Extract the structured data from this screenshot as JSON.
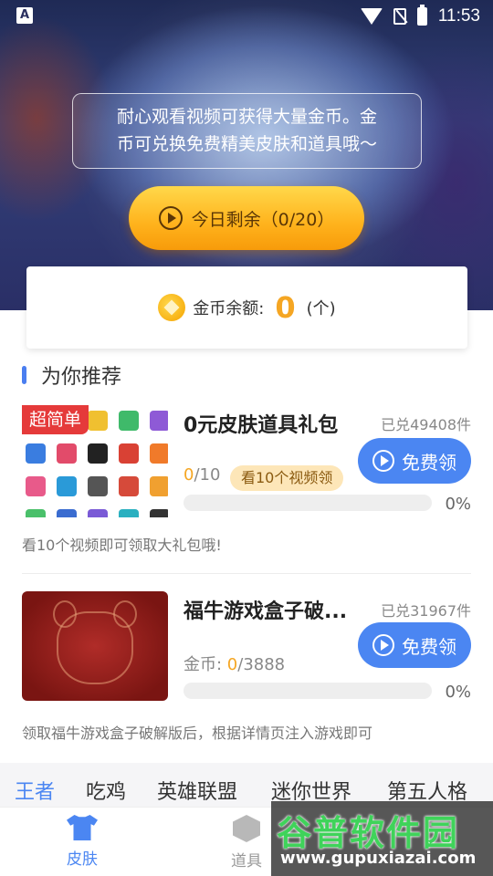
{
  "status_bar": {
    "left_icon": "A",
    "time": "11:53",
    "icons": [
      "wifi-icon",
      "no-sim-icon",
      "battery-charging-icon"
    ]
  },
  "hero": {
    "info_text_line1": "耐心观看视频可获得大量金币。金",
    "info_text_line2": "币可兑换免费精美皮肤和道具哦～",
    "remain_label": "今日剩余（0/20）"
  },
  "coin_balance": {
    "label": "金币余额:",
    "value": "0",
    "unit": "(个)"
  },
  "section": {
    "title": "为你推荐"
  },
  "items": [
    {
      "tag": "超简单",
      "title": "0元皮肤道具礼包",
      "redeemed": "已兑49408件",
      "button": "免费领",
      "progress_current": "0",
      "progress_total": "/10",
      "watch_hint": "看10个视频领",
      "percent": "0%",
      "progress_fraction": 0,
      "desc": "看10个视频即可领取大礼包哦!"
    },
    {
      "title": "福牛游戏盒子破...",
      "redeemed": "已兑31967件",
      "button": "免费领",
      "coin_label": "金币: ",
      "progress_current": "0",
      "progress_total": "/3888",
      "percent": "0%",
      "progress_fraction": 0,
      "desc": "领取福牛游戏盒子破解版后，根据详情页注入游戏即可"
    }
  ],
  "category_tabs": [
    "王者",
    "吃鸡",
    "英雄联盟",
    "迷你世界",
    "第五人格"
  ],
  "bottom_nav": [
    {
      "label": "皮肤",
      "icon": "shirt-icon",
      "active": true
    },
    {
      "label": "道具",
      "icon": "cube-icon",
      "active": false
    }
  ],
  "watermark": {
    "title": "谷普软件园",
    "url": "www.gupuxiazai.com"
  },
  "colors": {
    "accent": "#4b86f2",
    "coin": "#f5a623",
    "tag_red": "#e53a3a",
    "button_gold": "#ffc42c"
  }
}
